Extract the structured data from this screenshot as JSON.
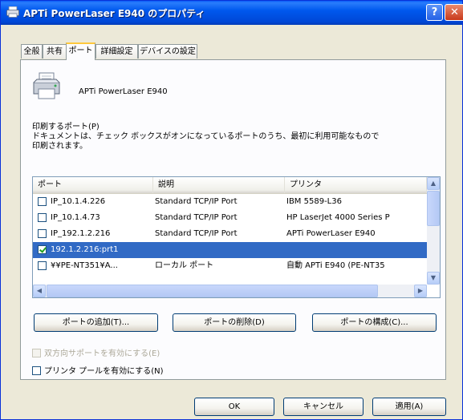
{
  "window": {
    "title": "APTi PowerLaser E940 のプロパティ",
    "help_label": "?",
    "close_label": "✕"
  },
  "tabs": [
    {
      "label": "全般"
    },
    {
      "label": "共有"
    },
    {
      "label": "ポート",
      "active": true
    },
    {
      "label": "詳細設定"
    },
    {
      "label": "デバイスの設定"
    }
  ],
  "printer": {
    "name": "APTi PowerLaser E940",
    "icon": "printer-icon"
  },
  "ports_section": {
    "label": "印刷するポート(P)",
    "description_line1": "ドキュメントは、チェック ボックスがオンになっているポートのうち、最初に利用可能なもので",
    "description_line2": "印刷されます。"
  },
  "port_list": {
    "columns": [
      "ポート",
      "説明",
      "プリンタ"
    ],
    "rows": [
      {
        "checked": false,
        "port": "IP_10.1.4.226",
        "description": "Standard TCP/IP Port",
        "printer": "IBM 5589-L36"
      },
      {
        "checked": false,
        "port": "IP_10.1.4.73",
        "description": "Standard TCP/IP Port",
        "printer": "HP LaserJet 4000 Series P"
      },
      {
        "checked": false,
        "port": "IP_192.1.2.216",
        "description": "Standard TCP/IP Port",
        "printer": "APTi PowerLaser E940"
      },
      {
        "checked": true,
        "port": "192.1.2.216:prt1",
        "description": "",
        "printer": "",
        "selected": true
      },
      {
        "checked": false,
        "port": "¥¥PE-NT351¥A...",
        "description": "ローカル ポート",
        "printer": "自動 APTi E940 (PE-NT35"
      }
    ]
  },
  "buttons": {
    "add_port": "ポートの追加(T)...",
    "delete_port": "ポートの削除(D)",
    "configure_port": "ポートの構成(C)...",
    "ok": "OK",
    "cancel": "キャンセル",
    "apply": "適用(A)"
  },
  "options": {
    "bidirectional": "双方向サポートを有効にする(E)",
    "pooling": "プリンタ プールを有効にする(N)"
  }
}
